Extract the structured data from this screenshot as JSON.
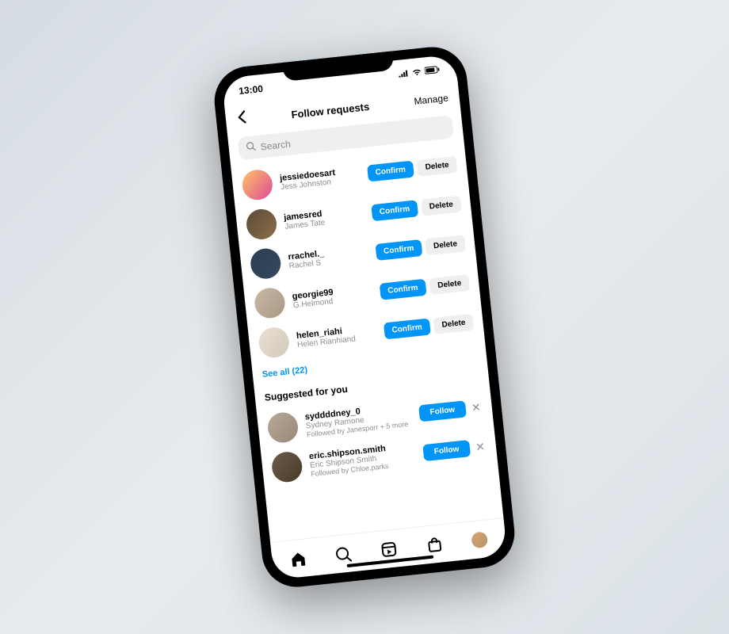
{
  "status": {
    "time": "13:00"
  },
  "header": {
    "title": "Follow requests",
    "manage": "Manage"
  },
  "search": {
    "placeholder": "Search"
  },
  "requests": [
    {
      "username": "jessiedoesart",
      "fullname": "Jess Johnston",
      "confirm": "Confirm",
      "delete": "Delete"
    },
    {
      "username": "jamesred",
      "fullname": "James Tate",
      "confirm": "Confirm",
      "delete": "Delete"
    },
    {
      "username": "rrachel._",
      "fullname": "Rachel S",
      "confirm": "Confirm",
      "delete": "Delete"
    },
    {
      "username": "georgie99",
      "fullname": "G.Helmond",
      "confirm": "Confirm",
      "delete": "Delete"
    },
    {
      "username": "helen_riahi",
      "fullname": "Helen Rianhiand",
      "confirm": "Confirm",
      "delete": "Delete"
    }
  ],
  "see_all": "See all (22)",
  "suggested_title": "Suggested for you",
  "suggestions": [
    {
      "username": "syddddney_0",
      "fullname": "Sydney Ramone",
      "followedby": "Followed by Janesporr + 5 more",
      "follow": "Follow"
    },
    {
      "username": "eric.shipson.smith",
      "fullname": "Eric Shipson Smith",
      "followedby": "Followed by Chloe.parks",
      "follow": "Follow"
    }
  ]
}
